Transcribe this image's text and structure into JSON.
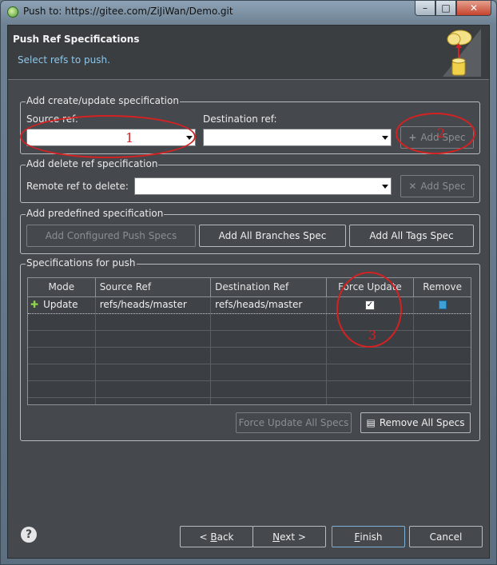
{
  "window": {
    "title": "Push to: https://gitee.com/ZiJiWan/Demo.git",
    "buttons": {
      "minimize": "–",
      "maximize": "□",
      "close": "✕"
    }
  },
  "header": {
    "title": "Push Ref Specifications",
    "subtitle": "Select refs to push."
  },
  "create_group": {
    "label": "Add create/update specification",
    "source_label": "Source ref:",
    "source_value": "",
    "dest_label": "Destination ref:",
    "dest_value": "",
    "add_spec": "Add Spec"
  },
  "delete_group": {
    "label": "Add delete ref specification",
    "remote_label": "Remote ref to delete:",
    "remote_value": "",
    "add_spec": "Add Spec"
  },
  "predefined_group": {
    "label": "Add predefined specification",
    "configured": "Add Configured Push Specs",
    "all_branches": "Add All Branches Spec",
    "all_tags": "Add All Tags Spec"
  },
  "specs_group": {
    "label": "Specifications for push",
    "columns": [
      "Mode",
      "Source Ref",
      "Destination Ref",
      "Force Update",
      "Remove"
    ],
    "rows": [
      {
        "mode": "Update",
        "source": "refs/heads/master",
        "destination": "refs/heads/master",
        "force_update": true
      }
    ],
    "force_update_all": "Force Update All Specs",
    "remove_all": "Remove All Specs"
  },
  "annotations": [
    "1",
    "2",
    "3"
  ],
  "footer": {
    "back_prefix": "< ",
    "back_key": "B",
    "back_rest": "ack",
    "next_key": "N",
    "next_rest": "ext >",
    "finish_key": "F",
    "finish_rest": "inish",
    "cancel": "Cancel",
    "help": "?"
  },
  "colors": {
    "annotation": "#d42121",
    "panel": "#45494d",
    "accent": "#8fc6ea"
  }
}
